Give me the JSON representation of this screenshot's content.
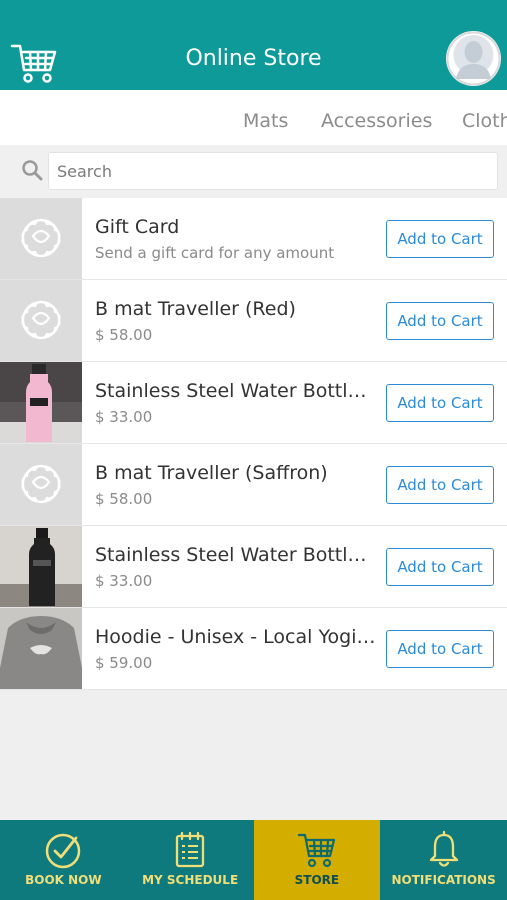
{
  "header": {
    "title": "Online Store",
    "cart_icon": "shopping-cart-icon",
    "avatar_icon": "user-avatar"
  },
  "tabs": [
    {
      "label": "Mats"
    },
    {
      "label": "Accessories"
    },
    {
      "label": "Clothing"
    }
  ],
  "search": {
    "placeholder": "Search",
    "value": "",
    "icon": "search-icon"
  },
  "products": [
    {
      "name": "Gift Card",
      "sub": "Send a gift card for any amount",
      "button": "Add to Cart",
      "thumb": "logo-placeholder"
    },
    {
      "name": "B mat Traveller (Red)",
      "sub": "$ 58.00",
      "button": "Add to Cart",
      "thumb": "logo-placeholder"
    },
    {
      "name": "Stainless Steel Water Bottle (Pink)",
      "sub": "$ 33.00",
      "button": "Add to Cart",
      "thumb": "pink-bottle-photo"
    },
    {
      "name": "B mat Traveller (Saffron)",
      "sub": "$ 58.00",
      "button": "Add to Cart",
      "thumb": "logo-placeholder"
    },
    {
      "name": "Stainless Steel Water Bottle (Black)",
      "sub": "$ 33.00",
      "button": "Add to Cart",
      "thumb": "black-bottle-photo"
    },
    {
      "name": "Hoodie - Unisex - Local Yogi (Grey)",
      "sub": "$ 59.00",
      "button": "Add to Cart",
      "thumb": "hoodie-photo"
    }
  ],
  "bottom_nav": [
    {
      "label": "BOOK NOW",
      "icon": "check-circle-icon",
      "active": false
    },
    {
      "label": "MY SCHEDULE",
      "icon": "calendar-list-icon",
      "active": false
    },
    {
      "label": "STORE",
      "icon": "shopping-cart-icon",
      "active": true
    },
    {
      "label": "NOTIFICATIONS",
      "icon": "bell-icon",
      "active": false
    }
  ],
  "colors": {
    "header": "#0f9a9a",
    "bottom_nav": "#0f7a7d",
    "active_tab": "#d3ad00",
    "nav_label": "#f0de77",
    "button": "#2b8bd8"
  }
}
